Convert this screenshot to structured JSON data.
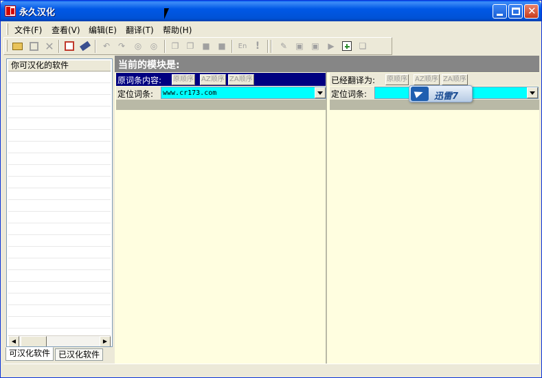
{
  "window": {
    "title": "永久汉化"
  },
  "menu": {
    "items": [
      {
        "label": "文件(F)"
      },
      {
        "label": "查看(V)"
      },
      {
        "label": "编辑(E)"
      },
      {
        "label": "翻译(T)"
      },
      {
        "label": "帮助(H)"
      }
    ]
  },
  "toolbar": {
    "icons": [
      "open-folder-icon",
      "save-icon",
      "delete-icon",
      "dictionary-icon",
      "brush-icon",
      "undo-icon",
      "redo-icon",
      "find-icon",
      "find-next-icon",
      "copy-icon",
      "paste-icon",
      "copy-all-icon",
      "paste-all-icon",
      "en-label",
      "exclamation-icon",
      "translate-icon",
      "window-edit-icon",
      "window-check-icon",
      "play-icon",
      "add-window-icon",
      "windows-icon"
    ],
    "en_label": "En",
    "exclaim_label": "!"
  },
  "left_pane": {
    "list_header": "你可汉化的软件",
    "tabs": [
      {
        "label": "可汉化软件",
        "active": true
      },
      {
        "label": "已汉化软件",
        "active": false
      }
    ]
  },
  "main": {
    "module_label": "当前的模块是:",
    "source": {
      "label": "原词条内容:",
      "sort_buttons": [
        "原顺序",
        "AZ顺序",
        "ZA顺序"
      ],
      "locate_label": "定位词条:",
      "locate_value": "www.cr173.com"
    },
    "translated": {
      "label": "已经翻译为:",
      "sort_buttons": [
        "原顺序",
        "AZ顺序",
        "ZA顺序"
      ],
      "locate_label": "定位词条:",
      "locate_value": ""
    }
  },
  "overlay": {
    "badge_text": "迅雷7"
  },
  "colors": {
    "title_bar": "#0054e3",
    "module_bar": "#868686",
    "source_header": "#000080",
    "locate_field": "#00ffff",
    "panel_bg": "#fffee0"
  }
}
